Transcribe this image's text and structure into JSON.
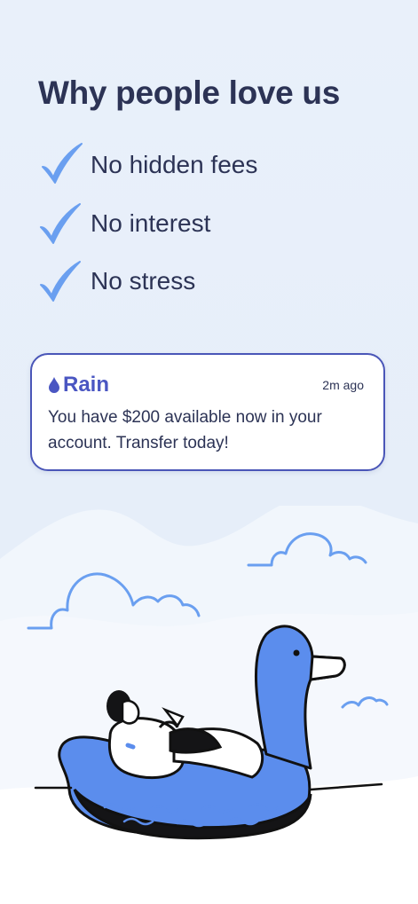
{
  "headline": "Why people love us",
  "benefits": [
    {
      "label": "No hidden fees",
      "icon": "check-icon"
    },
    {
      "label": "No interest",
      "icon": "check-icon"
    },
    {
      "label": "No stress",
      "icon": "check-icon"
    }
  ],
  "notification": {
    "brand": "Rain",
    "brand_icon": "raindrop-icon",
    "time": "2m ago",
    "message": "You have $200 available now in your account. Transfer today!"
  },
  "colors": {
    "background": "#e8eff9",
    "heading": "#2c3355",
    "accent": "#4a56c2",
    "check": "#6a9ff0",
    "float": "#6a9ff0"
  }
}
